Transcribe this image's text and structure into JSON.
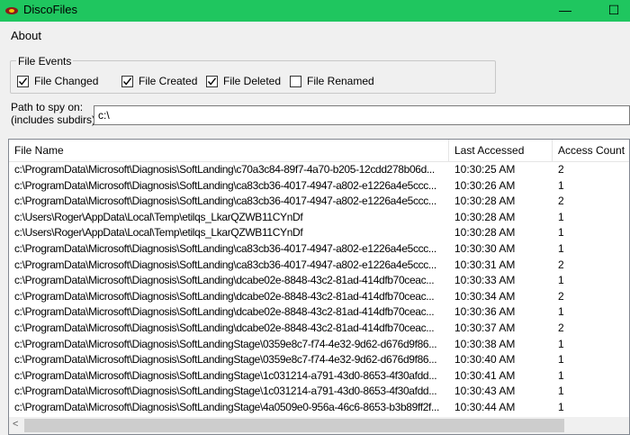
{
  "window": {
    "title": "DiscoFiles",
    "title_bar_color": "#1fc65f",
    "minimize_glyph": "—",
    "maximize_glyph": "☐"
  },
  "menu": {
    "about": "About"
  },
  "file_events": {
    "legend": "File Events",
    "options": [
      {
        "label": "File Changed",
        "checked": true
      },
      {
        "label": "File Created",
        "checked": true
      },
      {
        "label": "File Deleted",
        "checked": true
      },
      {
        "label": "File Renamed",
        "checked": false
      }
    ]
  },
  "path": {
    "label_line1": "Path to spy on:",
    "label_line2": "(includes subdirs)",
    "value": "c:\\"
  },
  "table": {
    "columns": [
      "File Name",
      "Last Accessed",
      "Access Count"
    ],
    "rows": [
      [
        "c:\\ProgramData\\Microsoft\\Diagnosis\\SoftLanding\\c70a3c84-89f7-4a70-b205-12cdd278b06d...",
        "10:30:25 AM",
        "2"
      ],
      [
        "c:\\ProgramData\\Microsoft\\Diagnosis\\SoftLanding\\ca83cb36-4017-4947-a802-e1226a4e5ccc...",
        "10:30:26 AM",
        "1"
      ],
      [
        "c:\\ProgramData\\Microsoft\\Diagnosis\\SoftLanding\\ca83cb36-4017-4947-a802-e1226a4e5ccc...",
        "10:30:28 AM",
        "2"
      ],
      [
        "c:\\Users\\Roger\\AppData\\Local\\Temp\\etilqs_LkarQZWB11CYnDf",
        "10:30:28 AM",
        "1"
      ],
      [
        "c:\\Users\\Roger\\AppData\\Local\\Temp\\etilqs_LkarQZWB11CYnDf",
        "10:30:28 AM",
        "1"
      ],
      [
        "c:\\ProgramData\\Microsoft\\Diagnosis\\SoftLanding\\ca83cb36-4017-4947-a802-e1226a4e5ccc...",
        "10:30:30 AM",
        "1"
      ],
      [
        "c:\\ProgramData\\Microsoft\\Diagnosis\\SoftLanding\\ca83cb36-4017-4947-a802-e1226a4e5ccc...",
        "10:30:31 AM",
        "2"
      ],
      [
        "c:\\ProgramData\\Microsoft\\Diagnosis\\SoftLanding\\dcabe02e-8848-43c2-81ad-414dfb70ceac...",
        "10:30:33 AM",
        "1"
      ],
      [
        "c:\\ProgramData\\Microsoft\\Diagnosis\\SoftLanding\\dcabe02e-8848-43c2-81ad-414dfb70ceac...",
        "10:30:34 AM",
        "2"
      ],
      [
        "c:\\ProgramData\\Microsoft\\Diagnosis\\SoftLanding\\dcabe02e-8848-43c2-81ad-414dfb70ceac...",
        "10:30:36 AM",
        "1"
      ],
      [
        "c:\\ProgramData\\Microsoft\\Diagnosis\\SoftLanding\\dcabe02e-8848-43c2-81ad-414dfb70ceac...",
        "10:30:37 AM",
        "2"
      ],
      [
        "c:\\ProgramData\\Microsoft\\Diagnosis\\SoftLandingStage\\0359e8c7-f74-4e32-9d62-d676d9f86...",
        "10:30:38 AM",
        "1"
      ],
      [
        "c:\\ProgramData\\Microsoft\\Diagnosis\\SoftLandingStage\\0359e8c7-f74-4e32-9d62-d676d9f86...",
        "10:30:40 AM",
        "1"
      ],
      [
        "c:\\ProgramData\\Microsoft\\Diagnosis\\SoftLandingStage\\1c031214-a791-43d0-8653-4f30afdd...",
        "10:30:41 AM",
        "1"
      ],
      [
        "c:\\ProgramData\\Microsoft\\Diagnosis\\SoftLandingStage\\1c031214-a791-43d0-8653-4f30afdd...",
        "10:30:43 AM",
        "1"
      ],
      [
        "c:\\ProgramData\\Microsoft\\Diagnosis\\SoftLandingStage\\4a0509e0-956a-46c6-8653-b3b89ff2f...",
        "10:30:44 AM",
        "1"
      ]
    ]
  },
  "scrollbar": {
    "left_arrow_glyph": "<"
  }
}
